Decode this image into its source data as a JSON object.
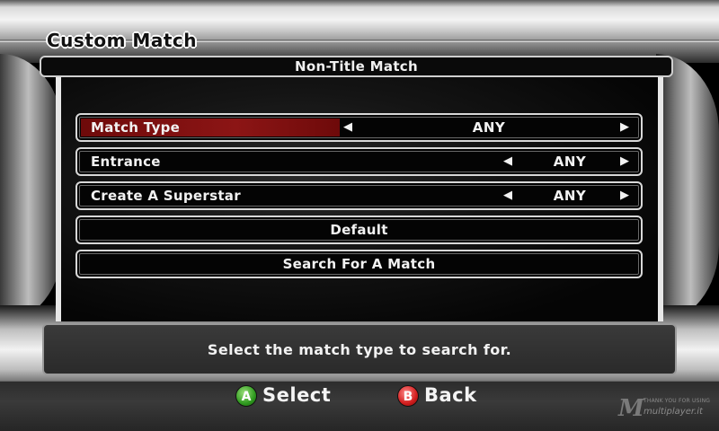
{
  "screen": {
    "title": "Custom Match",
    "panel_title": "Non-Title Match"
  },
  "options": [
    {
      "label": "Match Type",
      "value": "ANY",
      "selected": true
    },
    {
      "label": "Entrance",
      "value": "ANY",
      "selected": false
    },
    {
      "label": "Create A Superstar",
      "value": "ANY",
      "selected": false
    }
  ],
  "actions": {
    "default_label": "Default",
    "search_label": "Search For A Match"
  },
  "help_text": "Select the match type to search for.",
  "prompts": {
    "a_button": "A",
    "a_label": "Select",
    "b_button": "B",
    "b_label": "Back"
  },
  "arrows": {
    "left": "◀",
    "right": "▶"
  },
  "watermark": {
    "logo": "M",
    "tagline": "THANK YOU FOR USING",
    "brand": "multiplayer.it"
  },
  "colors": {
    "selection": "#8c1515",
    "a_button": "#2f9a1f",
    "b_button": "#d21d1d"
  }
}
